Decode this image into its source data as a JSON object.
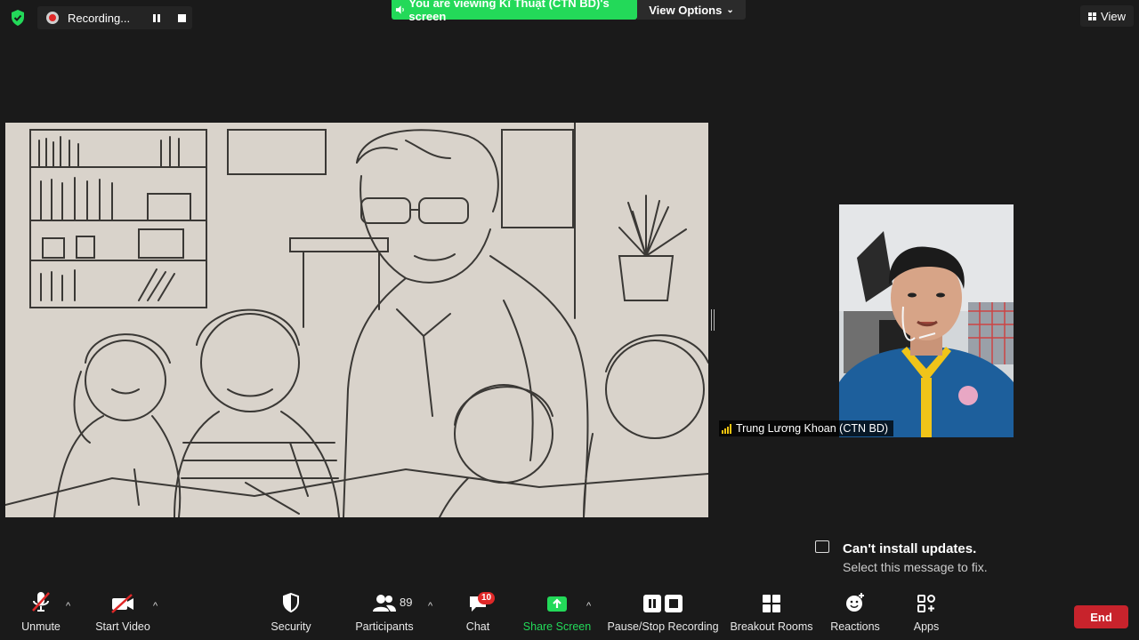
{
  "top_bar": {
    "recording_text": "Recording...",
    "viewing_banner": "You are viewing Kĩ Thuật (CTN BD)'s screen",
    "view_options_label": "View Options",
    "view_label": "View"
  },
  "participant": {
    "name": "Trung Lương Khoan (CTN BD)"
  },
  "notification": {
    "title": "Can't install updates.",
    "subtitle": "Select this message to fix."
  },
  "toolbar": {
    "unmute": "Unmute",
    "start_video": "Start Video",
    "security": "Security",
    "participants": "Participants",
    "participants_count": "89",
    "chat": "Chat",
    "chat_badge": "10",
    "share_screen": "Share Screen",
    "pause_stop_recording": "Pause/Stop Recording",
    "breakout_rooms": "Breakout Rooms",
    "reactions": "Reactions",
    "apps": "Apps",
    "end": "End"
  },
  "colors": {
    "green": "#23d959",
    "red": "#e02828",
    "end_red": "#c8232c",
    "background": "#1a1a1a"
  }
}
